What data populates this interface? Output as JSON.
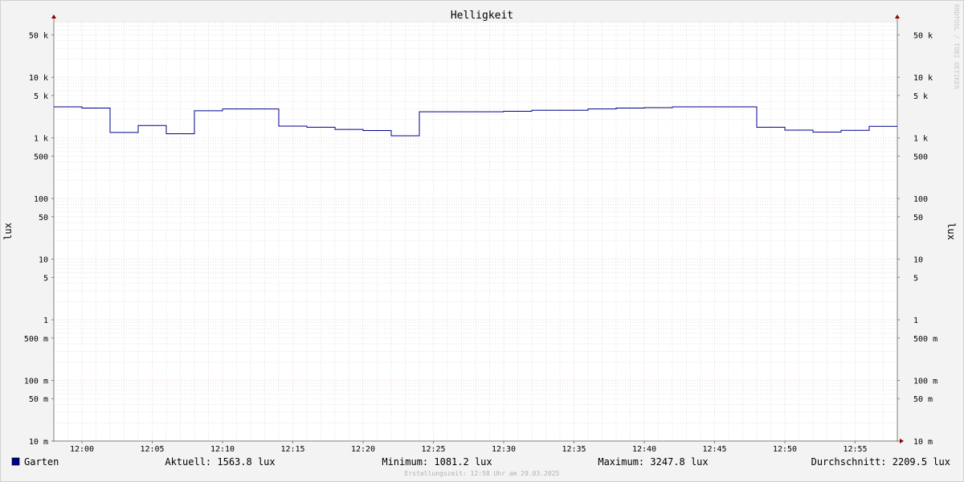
{
  "chart_data": {
    "type": "line",
    "title": "Helligkeit",
    "ylabel": "lux",
    "ylabel_right": "lux",
    "y_scale": "log",
    "ylim": [
      0.01,
      80000
    ],
    "xlim": [
      "11:58",
      "12:58"
    ],
    "grid": true,
    "y_ticks": [
      {
        "value": 50000,
        "label": "50 k"
      },
      {
        "value": 10000,
        "label": "10 k"
      },
      {
        "value": 5000,
        "label": "5 k"
      },
      {
        "value": 1000,
        "label": "1 k"
      },
      {
        "value": 500,
        "label": "500"
      },
      {
        "value": 100,
        "label": "100"
      },
      {
        "value": 50,
        "label": "50"
      },
      {
        "value": 10,
        "label": "10"
      },
      {
        "value": 5,
        "label": "5"
      },
      {
        "value": 1,
        "label": "1"
      },
      {
        "value": 0.5,
        "label": "500 m"
      },
      {
        "value": 0.1,
        "label": "100 m"
      },
      {
        "value": 0.05,
        "label": "50 m"
      },
      {
        "value": 0.01,
        "label": "10 m"
      }
    ],
    "x_ticks": [
      "12:00",
      "12:05",
      "12:10",
      "12:15",
      "12:20",
      "12:25",
      "12:30",
      "12:35",
      "12:40",
      "12:45",
      "12:50",
      "12:55"
    ],
    "series": [
      {
        "name": "Garten",
        "color": "#00008b",
        "x": [
          "11:58",
          "12:00",
          "12:02",
          "12:04",
          "12:06",
          "12:08",
          "12:10",
          "12:14",
          "12:16",
          "12:18",
          "12:20",
          "12:22",
          "12:24",
          "12:30",
          "12:32",
          "12:36",
          "12:38",
          "12:40",
          "12:42",
          "12:48",
          "12:50",
          "12:52",
          "12:54",
          "12:56",
          "12:58"
        ],
        "values": [
          3250,
          3100,
          1230,
          1600,
          1170,
          2800,
          3000,
          1560,
          1500,
          1380,
          1320,
          1085,
          2700,
          2750,
          2850,
          3000,
          3100,
          3150,
          3248,
          1500,
          1340,
          1250,
          1330,
          1550,
          1550
        ]
      }
    ],
    "legend": [
      {
        "name": "Garten",
        "color": "#00008b"
      }
    ],
    "stats": {
      "current": "Aktuell: 1563.8 lux",
      "minimum": "Minimum: 1081.2 lux",
      "maximum": "Maximum: 3247.8 lux",
      "average": "Durchschnitt: 2209.5 lux"
    },
    "watermark": "RRDTOOL / TOBI OETIKER",
    "footer": "Erstellungszeit: 12:58 Uhr am 29.03.2025"
  },
  "colors": {
    "background": "#f3f3f3",
    "canvas": "#ffffff",
    "grid_major": "#e8b8c2",
    "grid_minor": "#d0d0d0",
    "axis": "#808080",
    "arrow": "#8b0000",
    "text": "#000000",
    "watermark": "#c8c8c8",
    "footer": "#b0b0b0"
  }
}
